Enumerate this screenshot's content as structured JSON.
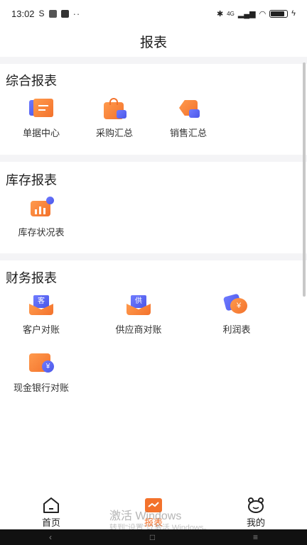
{
  "status_bar": {
    "time": "13:02",
    "network_label": "4G"
  },
  "title": "报表",
  "sections": [
    {
      "title": "综合报表",
      "items": [
        {
          "label": "单据中心",
          "icon": "document-center-icon"
        },
        {
          "label": "采购汇总",
          "icon": "purchase-bag-icon"
        },
        {
          "label": "销售汇总",
          "icon": "sales-tag-icon"
        }
      ]
    },
    {
      "title": "库存报表",
      "items": [
        {
          "label": "库存状况表",
          "icon": "inventory-chart-icon"
        }
      ]
    },
    {
      "title": "财务报表",
      "items": [
        {
          "label": "客户对账",
          "icon": "customer-reconcile-icon",
          "badge": "客"
        },
        {
          "label": "供应商对账",
          "icon": "supplier-reconcile-icon",
          "badge": "供"
        },
        {
          "label": "利润表",
          "icon": "profit-icon",
          "badge": "¥"
        },
        {
          "label": "现金银行对账",
          "icon": "cash-bank-icon",
          "badge": "¥"
        }
      ]
    }
  ],
  "tabs": [
    {
      "label": "首页",
      "icon": "home-icon",
      "active": false
    },
    {
      "label": "报表",
      "icon": "report-icon",
      "active": true
    },
    {
      "label": "我的",
      "icon": "profile-icon",
      "active": false
    }
  ],
  "watermark": {
    "line1": "激活 Windows",
    "line2": "转到\"设置\"以激活 Windows。"
  },
  "colors": {
    "accent": "#f3722c",
    "secondary": "#5b67f0",
    "gap": "#f4f4f6"
  }
}
